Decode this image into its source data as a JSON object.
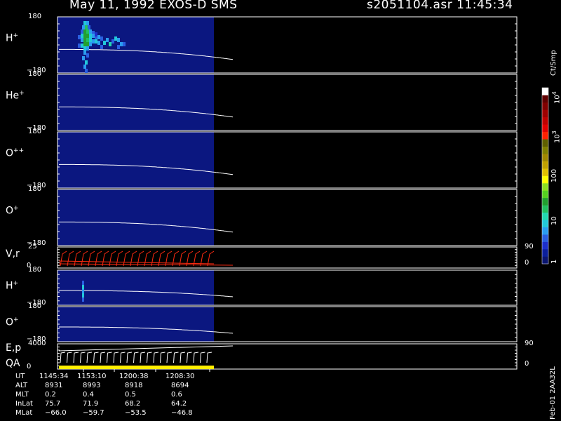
{
  "header": {
    "date_title": "May 11, 1992   EXOS-D SMS",
    "file_time": "s2051104.asr  11:45:34"
  },
  "colors": {
    "background": "#000000",
    "panel_fill": "#0b1780",
    "trace": "#ffffff",
    "red_trace": "#ff2a10",
    "qa_bar": "#ffee00"
  },
  "chart_data": {
    "type": "heatmap",
    "x_unit": "UT",
    "panels": [
      {
        "id": "h-plus-top",
        "label": "H",
        "charge": "+",
        "ymax": "180",
        "ymin": "−180"
      },
      {
        "id": "he-plus",
        "label": "He",
        "charge": "+",
        "ymax": "180",
        "ymin": "−180"
      },
      {
        "id": "o-plus-plus",
        "label": "O",
        "charge": "++",
        "ymax": "180",
        "ymin": "−180"
      },
      {
        "id": "o-plus-top",
        "label": "O",
        "charge": "+",
        "ymax": "180",
        "ymin": "−180"
      },
      {
        "id": "vr",
        "label": "V,r",
        "charge": "",
        "ymax": "25",
        "ymin": "0",
        "right_max": "90",
        "right_min": "0"
      },
      {
        "id": "h-plus-low",
        "label": "H",
        "charge": "+",
        "ymax": "180",
        "ymin": "−180"
      },
      {
        "id": "o-plus-low",
        "label": "O",
        "charge": "+",
        "ymax": "180",
        "ymin": "−180"
      },
      {
        "id": "ep-qa",
        "label": "E,p",
        "label2": "QA",
        "charge": "",
        "ymax": "4000",
        "ymin": "0",
        "right_max": "90",
        "right_min": "0"
      }
    ],
    "colorbar": {
      "unit": "Ct/Smp",
      "tick_labels": [
        "1",
        "10",
        "100",
        "10",
        "10"
      ],
      "tick_exponents": [
        "",
        "",
        "",
        "3",
        "4"
      ],
      "colors": [
        "#0a1570",
        "#0b1f9c",
        "#1c2fcb",
        "#2a5fe0",
        "#2a9cf0",
        "#22c8d8",
        "#22d8b0",
        "#22c060",
        "#22a030",
        "#55d020",
        "#8ee020",
        "#ffff00",
        "#e0c000",
        "#c0a000",
        "#a08800",
        "#808000",
        "#606000",
        "#ff2000",
        "#e00000",
        "#c00000",
        "#a00000",
        "#800000",
        "#600000",
        "#ffffff"
      ]
    },
    "x_tick_labels": [
      "1145:34",
      "1153:10",
      "1200:38",
      "1208:30"
    ],
    "ephemeris": [
      {
        "name": "UT",
        "values": [
          "1145:34",
          "1153:10",
          "1200:38",
          "1208:30"
        ]
      },
      {
        "name": "ALT",
        "values": [
          "8931",
          "8993",
          "8918",
          "8694"
        ]
      },
      {
        "name": "MLT",
        "values": [
          "0.2",
          "0.4",
          "0.5",
          "0.6"
        ]
      },
      {
        "name": "InLat",
        "values": [
          "75.7",
          "71.9",
          "68.2",
          "64.2"
        ]
      },
      {
        "name": "MLat",
        "values": [
          "−66.0",
          "−59.7",
          "−53.5",
          "−46.8"
        ]
      }
    ],
    "side_label": "Feb-01 2AA32L"
  }
}
